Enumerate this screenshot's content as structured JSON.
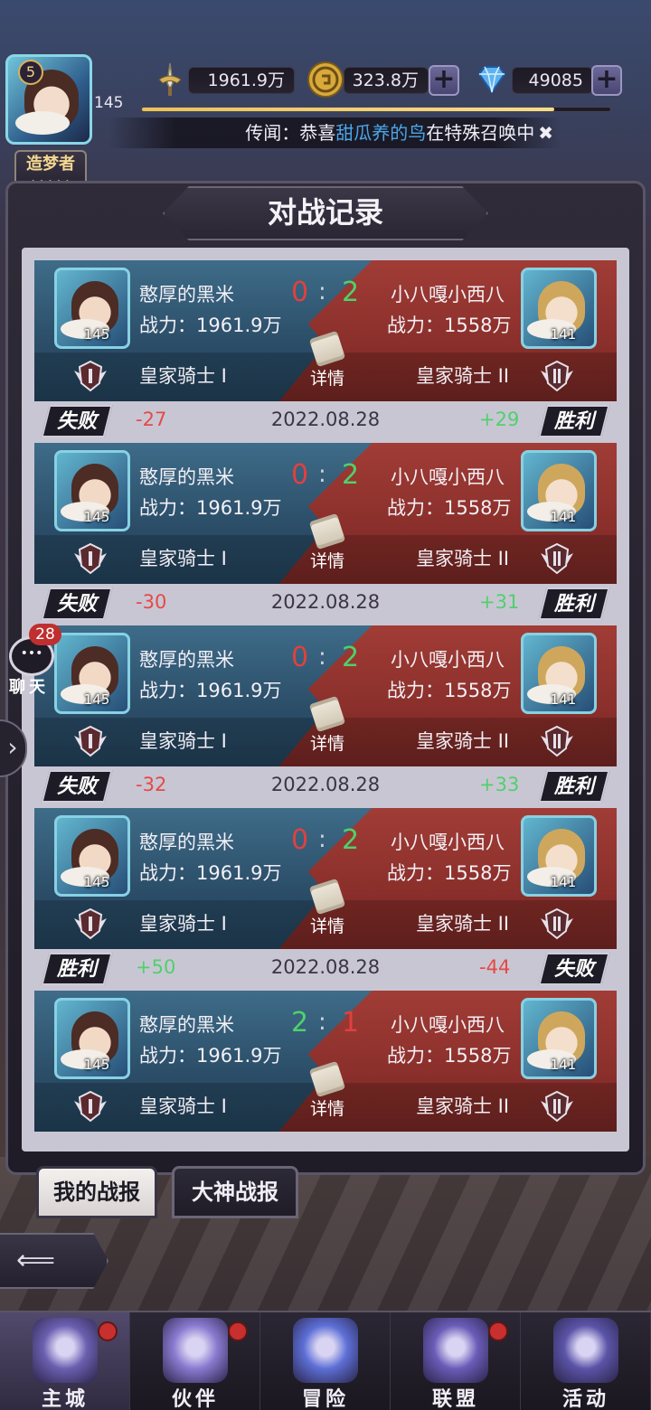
{
  "hud": {
    "level": "5",
    "player_level_value": "145",
    "power": "1961.9万",
    "gold": "323.8万",
    "gems": "49085",
    "exp_fraction": 0.88,
    "rumor_prefix": "传闻：恭喜",
    "rumor_name": "甜瓜养的鸟",
    "rumor_suffix": "在特殊召唤中",
    "title_badge": "造梦者",
    "title_stars": "◆◆◆◆◆"
  },
  "panel": {
    "title": "对战记录"
  },
  "records": [
    {
      "me_name": "憨厚的黑米",
      "me_power": "战力：1961.9万",
      "me_level": "145",
      "me_rank": "皇家骑士 I",
      "opp_name": "小八嘎小西八",
      "opp_power": "战力：1558万",
      "opp_level": "141",
      "opp_rank": "皇家骑士 II",
      "score_left": "0",
      "score_right": "2",
      "score_left_color": "red",
      "score_right_color": "green",
      "detail_label": "详情",
      "result_left": "失败",
      "delta_left": "-27",
      "date": "2022.08.28",
      "delta_right": "+29",
      "result_right": "胜利"
    },
    {
      "me_name": "憨厚的黑米",
      "me_power": "战力：1961.9万",
      "me_level": "145",
      "me_rank": "皇家骑士 I",
      "opp_name": "小八嘎小西八",
      "opp_power": "战力：1558万",
      "opp_level": "141",
      "opp_rank": "皇家骑士 II",
      "score_left": "0",
      "score_right": "2",
      "score_left_color": "red",
      "score_right_color": "green",
      "detail_label": "详情",
      "result_left": "失败",
      "delta_left": "-30",
      "date": "2022.08.28",
      "delta_right": "+31",
      "result_right": "胜利"
    },
    {
      "me_name": "憨厚的黑米",
      "me_power": "战力：1961.9万",
      "me_level": "145",
      "me_rank": "皇家骑士 I",
      "opp_name": "小八嘎小西八",
      "opp_power": "战力：1558万",
      "opp_level": "141",
      "opp_rank": "皇家骑士 II",
      "score_left": "0",
      "score_right": "2",
      "score_left_color": "red",
      "score_right_color": "green",
      "detail_label": "详情",
      "result_left": "失败",
      "delta_left": "-32",
      "date": "2022.08.28",
      "delta_right": "+33",
      "result_right": "胜利"
    },
    {
      "me_name": "憨厚的黑米",
      "me_power": "战力：1961.9万",
      "me_level": "145",
      "me_rank": "皇家骑士 I",
      "opp_name": "小八嘎小西八",
      "opp_power": "战力：1558万",
      "opp_level": "141",
      "opp_rank": "皇家骑士 II",
      "score_left": "0",
      "score_right": "2",
      "score_left_color": "red",
      "score_right_color": "green",
      "detail_label": "详情",
      "result_left": "胜利",
      "delta_left": "+50",
      "date": "2022.08.28",
      "delta_right": "-44",
      "result_right": "失败"
    },
    {
      "me_name": "憨厚的黑米",
      "me_power": "战力：1961.9万",
      "me_level": "145",
      "me_rank": "皇家骑士 I",
      "opp_name": "小八嘎小西八",
      "opp_power": "战力：1558万",
      "opp_level": "141",
      "opp_rank": "皇家骑士 II",
      "score_left": "2",
      "score_right": "1",
      "score_left_color": "green",
      "score_right_color": "red",
      "detail_label": "详情"
    }
  ],
  "chat": {
    "count": "28",
    "label": "聊天"
  },
  "tabs": {
    "my_reports": "我的战报",
    "master_reports": "大神战报"
  },
  "nav": [
    {
      "label": "主城",
      "icon": "castle-icon",
      "dot": true
    },
    {
      "label": "伙伴",
      "icon": "wizard-hat-icon",
      "dot": true
    },
    {
      "label": "冒险",
      "icon": "compass-crystal-icon",
      "dot": false
    },
    {
      "label": "联盟",
      "icon": "shield-emblem-icon",
      "dot": true
    },
    {
      "label": "活动",
      "icon": "cards-icon",
      "dot": false
    }
  ],
  "colors": {
    "win_green": "#4fd16b",
    "loss_red": "#e0413e",
    "accent_blue": "#4ba6e8"
  }
}
